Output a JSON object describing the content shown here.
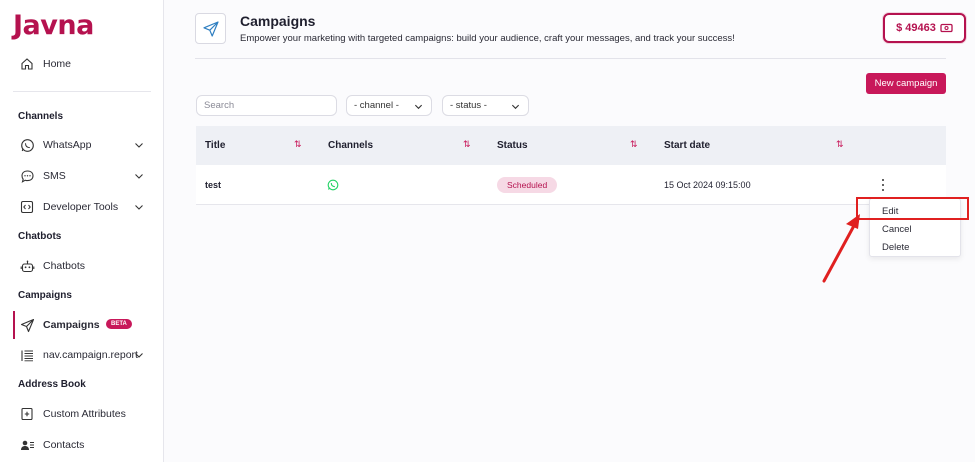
{
  "app": {
    "logo": "Javna"
  },
  "sidebar": {
    "home": "Home",
    "sections": {
      "channels": "Channels",
      "chatbots": "Chatbots",
      "campaigns": "Campaigns",
      "address_book": "Address Book"
    },
    "items": {
      "whatsapp": "WhatsApp",
      "sms": "SMS",
      "developer_tools": "Developer Tools",
      "chatbots": "Chatbots",
      "campaigns": "Campaigns",
      "campaigns_badge": "BETA",
      "campaign_report": "nav.campaign.report",
      "custom_attributes": "Custom Attributes",
      "contacts": "Contacts"
    }
  },
  "header": {
    "title": "Campaigns",
    "subtitle": "Empower your marketing with targeted campaigns: build your audience, craft your messages, and track your success!",
    "balance": "$ 49463"
  },
  "toolbar": {
    "new_campaign": "New campaign",
    "search_placeholder": "Search",
    "channel_filter": "- channel -",
    "status_filter": "- status -"
  },
  "table": {
    "columns": [
      "Title",
      "Channels",
      "Status",
      "Start date"
    ],
    "rows": [
      {
        "title": "test",
        "channel_icon": "whatsapp-icon",
        "status": "Scheduled",
        "start_date": "15 Oct 2024 09:15:00"
      }
    ]
  },
  "row_menu": {
    "items": [
      "Edit",
      "Cancel",
      "Delete"
    ]
  },
  "colors": {
    "brand": "#c8185a",
    "annotation": "#e02020",
    "whatsapp": "#25d366"
  }
}
